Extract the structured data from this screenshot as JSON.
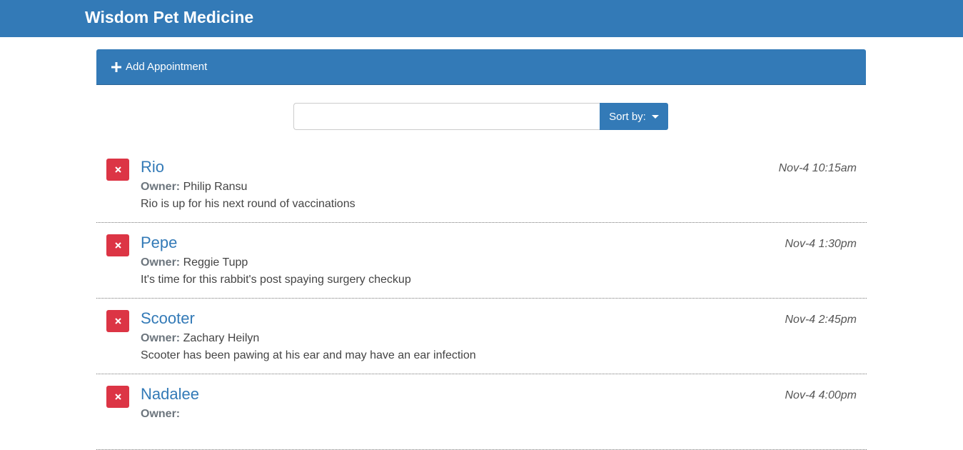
{
  "app": {
    "brand": "Wisdom Pet Medicine"
  },
  "add_panel": {
    "icon": "plus-icon",
    "label": "Add Appointment"
  },
  "search": {
    "value": "",
    "placeholder": "",
    "sort_label": "Sort by:"
  },
  "colors": {
    "primary": "#337ab7",
    "danger": "#dc3545"
  },
  "appointments": [
    {
      "pet_name": "Rio",
      "date": "Nov-4 10:15am",
      "owner_label": "Owner:",
      "owner": "Philip Ransu",
      "notes": "Rio is up for his next round of vaccinations"
    },
    {
      "pet_name": "Pepe",
      "date": "Nov-4 1:30pm",
      "owner_label": "Owner:",
      "owner": "Reggie Tupp",
      "notes": "It's time for this rabbit's post spaying surgery checkup"
    },
    {
      "pet_name": "Scooter",
      "date": "Nov-4 2:45pm",
      "owner_label": "Owner:",
      "owner": "Zachary Heilyn",
      "notes": "Scooter has been pawing at his ear and may have an ear infection"
    },
    {
      "pet_name": "Nadalee",
      "date": "Nov-4 4:00pm",
      "owner_label": "Owner:",
      "owner": "",
      "notes": ""
    }
  ]
}
